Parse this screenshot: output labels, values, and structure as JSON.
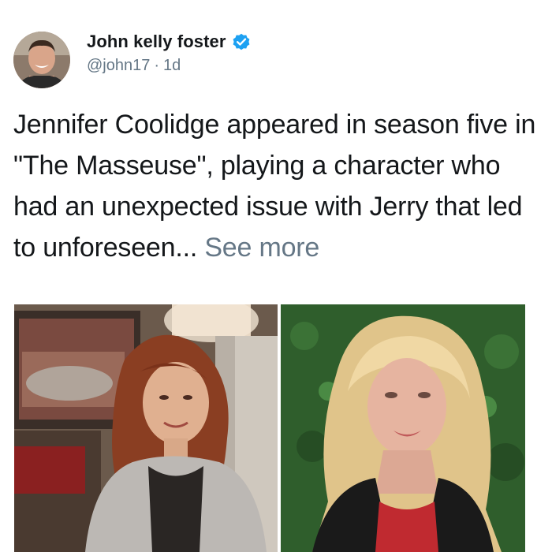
{
  "author": {
    "display_name": "John kelly foster",
    "handle": "@john17",
    "time": "1d",
    "separator": "·",
    "avatar_icon": "person-avatar",
    "verified_icon": "verified-badge-icon",
    "verified_color": "#1da1f2"
  },
  "tweet": {
    "text": "Jennifer Coolidge appeared in season five in \"The Masseuse\", playing a character who had an unexpected issue with Jerry that led to unforeseen...",
    "see_more_label": "See more"
  },
  "media": {
    "left_image": "tv-scene-woman-brown-hair-photo",
    "right_image": "woman-blonde-hair-hedge-backdrop-photo"
  },
  "colors": {
    "text_primary": "#14171a",
    "text_secondary": "#657786",
    "accent": "#1da1f2"
  }
}
